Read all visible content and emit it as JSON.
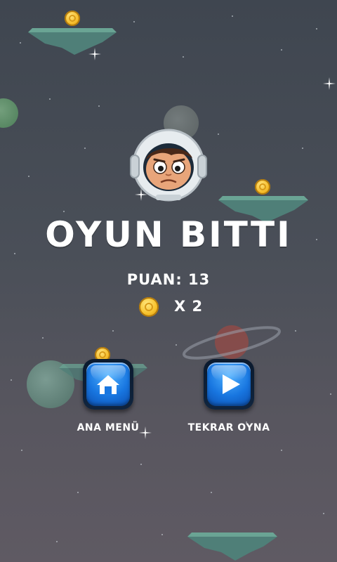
{
  "game": {
    "title": "OYUN BITTI",
    "score_text": "PUAN: 13",
    "coins_text": "X 2"
  },
  "buttons": {
    "home_label": "ANA MENÜ",
    "replay_label": "TEKRAR OYNA"
  },
  "icons": {
    "home": "home-icon",
    "play": "play-icon",
    "coin": "coin-icon"
  },
  "colors": {
    "background": "#4a4f58",
    "text": "#ffffff",
    "button_blue": "#1876e0",
    "platform_green": "#5f9d8f",
    "coin_gold": "#f5bc2a"
  }
}
